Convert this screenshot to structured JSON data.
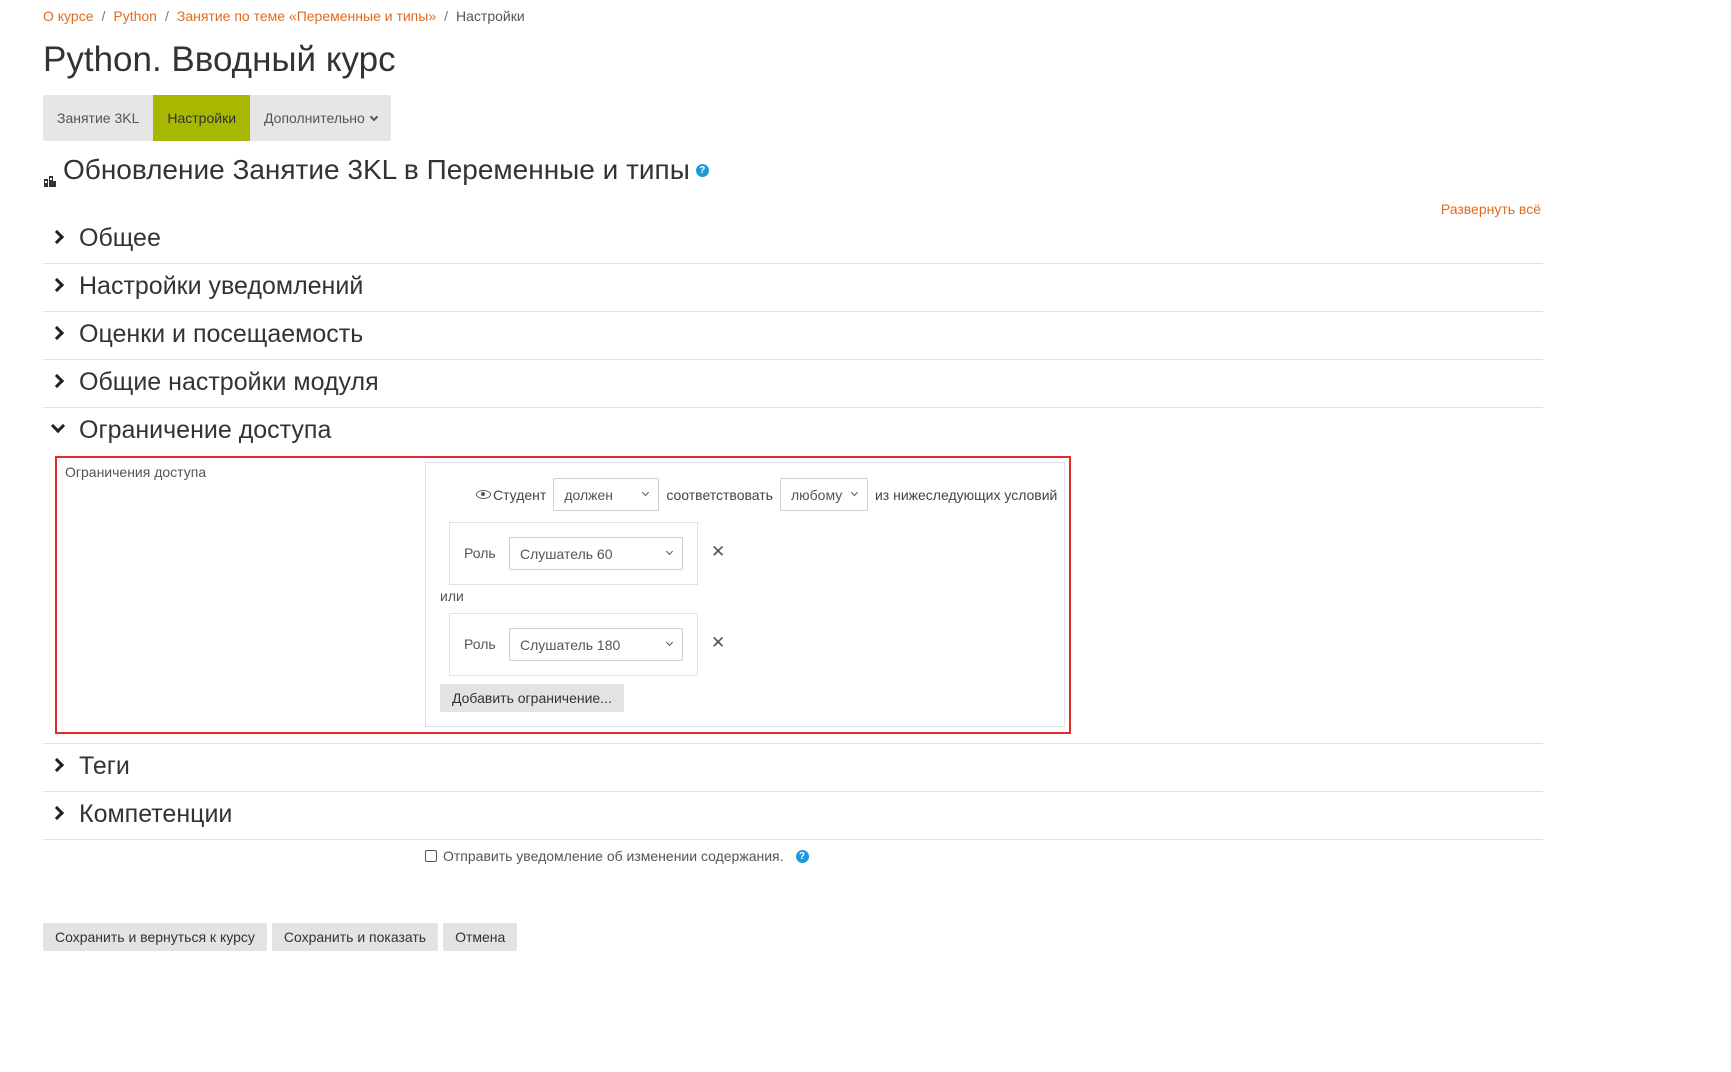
{
  "breadcrumb": {
    "items": [
      "О курсе",
      "Python",
      "Занятие по теме «Переменные и типы»",
      "Настройки"
    ],
    "separator": "/"
  },
  "page": {
    "title": "Python. Вводный курс"
  },
  "nav_tabs": {
    "tabs": [
      {
        "label": "Занятие 3KL",
        "active": false
      },
      {
        "label": "Настройки",
        "active": true
      },
      {
        "label": "Дополнительно",
        "active": false
      }
    ]
  },
  "heading": {
    "text": "Обновление Занятие 3KL в Переменные и типы",
    "icon": "module-icon",
    "help_icon": "?"
  },
  "expand_all": "Развернуть всё",
  "sections": [
    {
      "label": "Общее",
      "expanded": false
    },
    {
      "label": "Настройки уведомлений",
      "expanded": false
    },
    {
      "label": "Оценки и посещаемость",
      "expanded": false
    },
    {
      "label": "Общие настройки модуля",
      "expanded": false
    },
    {
      "label": "Ограничение доступа",
      "expanded": true
    },
    {
      "label": "Теги",
      "expanded": false
    },
    {
      "label": "Компетенции",
      "expanded": false
    }
  ],
  "restrict": {
    "label": "Ограничения доступа",
    "student_label": "Студент",
    "must_select": "должен",
    "match_label": "соответствовать",
    "any_select": "любому",
    "conditions_suffix": "из нижеследующих условий",
    "conditions": [
      {
        "label": "Роль",
        "value": "Слушатель 60"
      },
      {
        "label": "Роль",
        "value": "Слушатель 180"
      }
    ],
    "or_label": "или",
    "delete_glyph": "✕",
    "add_button": "Добавить ограничение..."
  },
  "notify": {
    "label": "Отправить уведомление об изменении содержания.",
    "checked": false,
    "help_icon": "?"
  },
  "buttons": {
    "save_return": "Сохранить и вернуться к курсу",
    "save_show": "Сохранить и показать",
    "cancel": "Отмена"
  },
  "colors": {
    "accent": "#e06b1f",
    "active_tab": "#a8b800",
    "help": "#1e9bd7",
    "highlight_border": "#e12a2a"
  }
}
